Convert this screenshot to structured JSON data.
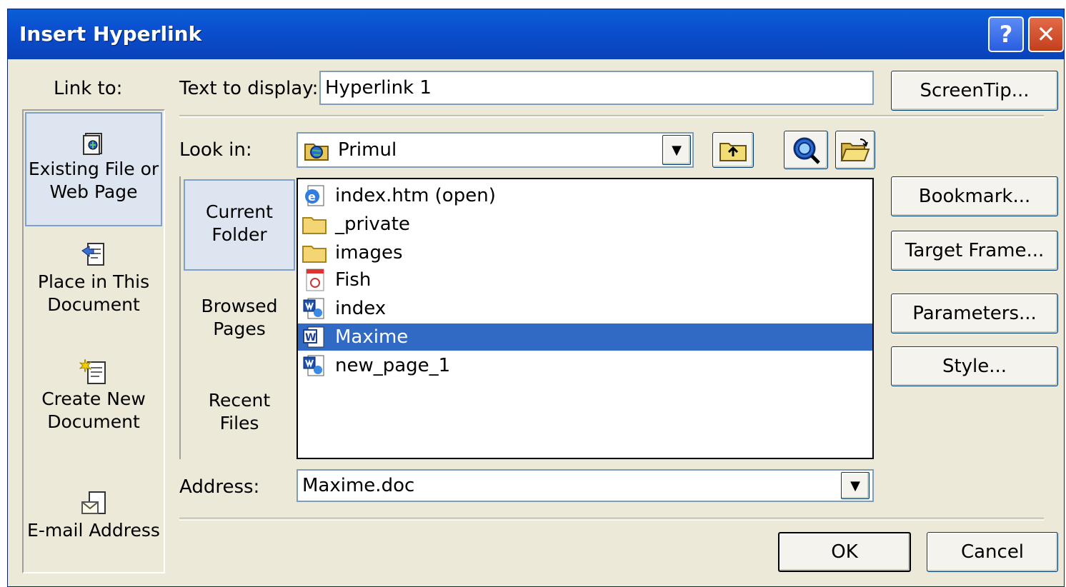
{
  "window": {
    "title": "Insert Hyperlink",
    "help_label": "?",
    "close_label": "✕"
  },
  "link_to": {
    "label": "Link to:",
    "items": [
      {
        "line1": "Existing File or",
        "line2": "Web Page"
      },
      {
        "line1": "Place in This",
        "line2": "Document"
      },
      {
        "line1": "Create New",
        "line2": "Document"
      },
      {
        "line1": "E-mail Address",
        "line2": ""
      }
    ]
  },
  "text_to_display": {
    "label": "Text to display:",
    "value": "Hyperlink 1"
  },
  "look_in": {
    "label": "Look in:",
    "value": "Primul"
  },
  "nav": {
    "items": [
      {
        "line1": "Current",
        "line2": "Folder"
      },
      {
        "line1": "Browsed",
        "line2": "Pages"
      },
      {
        "line1": "Recent",
        "line2": "Files"
      }
    ]
  },
  "files": [
    {
      "name": "index.htm (open)",
      "icon": "ie-page-icon"
    },
    {
      "name": "_private",
      "icon": "folder-icon"
    },
    {
      "name": "images",
      "icon": "folder-icon"
    },
    {
      "name": "Fish",
      "icon": "pdf-file-icon"
    },
    {
      "name": "index",
      "icon": "web-page-icon"
    },
    {
      "name": "Maxime",
      "icon": "word-doc-icon",
      "selected": true
    },
    {
      "name": "new_page_1",
      "icon": "web-page-icon"
    }
  ],
  "address": {
    "label": "Address:",
    "value": "Maxime.doc"
  },
  "buttons": {
    "screentip": "ScreenTip...",
    "bookmark": "Bookmark...",
    "target_frame": "Target Frame...",
    "parameters": "Parameters...",
    "style": "Style...",
    "ok": "OK",
    "cancel": "Cancel"
  },
  "colors": {
    "titlebar": "#0a4fd0",
    "selection": "#316ac5",
    "dialog_bg": "#ece9d8"
  }
}
